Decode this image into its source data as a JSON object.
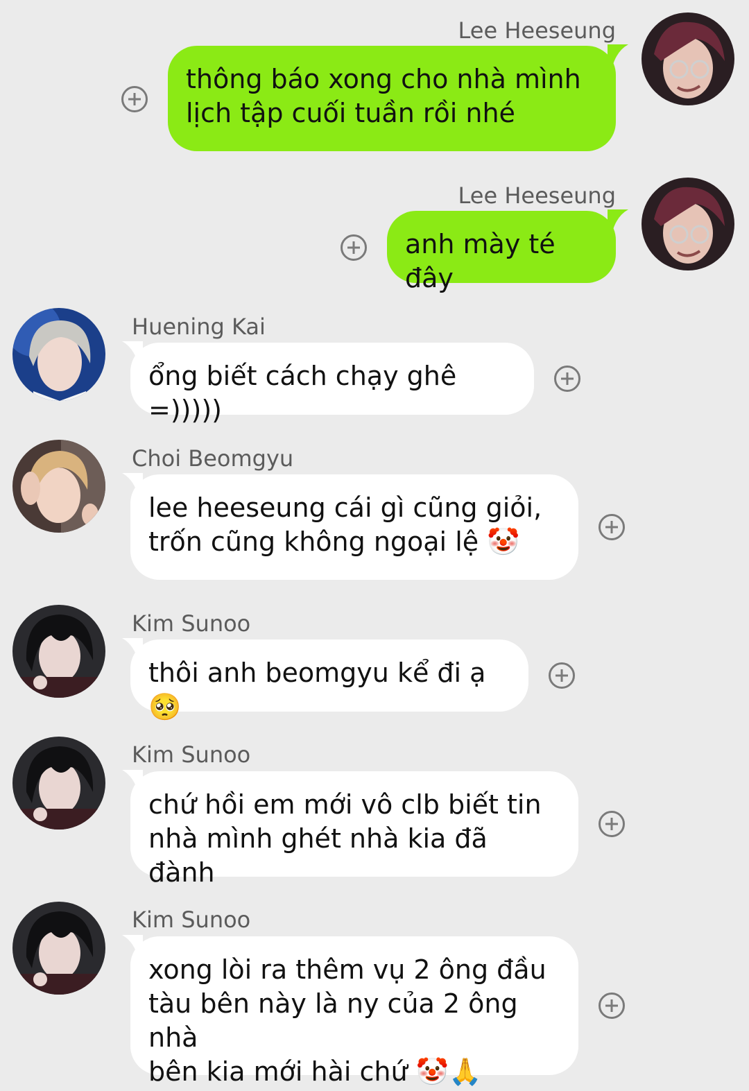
{
  "messages": [
    {
      "sender": "Lee Heeseung",
      "direction": "outgoing",
      "text": "thông báo xong cho nhà mình\nlịch tập cuối tuần rồi nhé",
      "avatar_icon": "user-avatar"
    },
    {
      "sender": "Lee Heeseung",
      "direction": "outgoing",
      "text": "anh mày té đây",
      "avatar_icon": "user-avatar"
    },
    {
      "sender": "Huening Kai",
      "direction": "incoming",
      "text": "ổng biết cách chạy ghê =)))))",
      "avatar_icon": "user-avatar"
    },
    {
      "sender": "Choi Beomgyu",
      "direction": "incoming",
      "text": "lee heeseung cái gì cũng giỏi,\ntrốn cũng không ngoại lệ 🤡",
      "avatar_icon": "user-avatar"
    },
    {
      "sender": "Kim Sunoo",
      "direction": "incoming",
      "text": "thôi anh beomgyu kể đi ạ 🥺",
      "avatar_icon": "user-avatar"
    },
    {
      "sender": "Kim Sunoo",
      "direction": "incoming",
      "text": "chứ hồi em mới vô clb biết tin\nnhà mình ghét nhà kia đã đành",
      "avatar_icon": "user-avatar"
    },
    {
      "sender": "Kim Sunoo",
      "direction": "incoming",
      "text": "xong lòi ra thêm vụ 2 ông đầu\ntàu bên này là ny của 2 ông nhà\nbên kia mới hài chứ 🤡🙏",
      "avatar_icon": "user-avatar"
    }
  ],
  "colors": {
    "background": "#ebebeb",
    "outgoing_bubble": "#8bea15",
    "incoming_bubble": "#ffffff",
    "sender_name": "#5b5b5b",
    "add_reaction_icon": "#7a7a7a"
  },
  "icons": {
    "add_reaction": "plus-circle-icon"
  }
}
